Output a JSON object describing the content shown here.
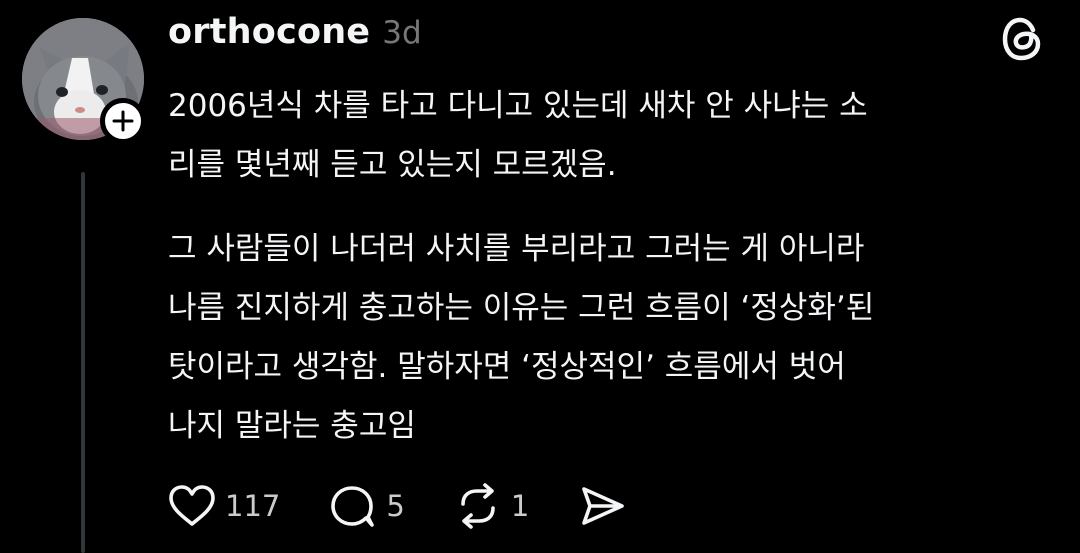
{
  "post": {
    "username": "orthocone",
    "timestamp": "3d",
    "paragraphs": [
      [
        "2006년식 차를 타고 다니고 있는데 새차 안 사냐는 소",
        "리를 몇년째 듣고 있는지 모르겠음."
      ],
      [
        "그 사람들이 나더러 사치를 부리라고 그러는 게 아니라",
        "나름 진지하게 충고하는 이유는 그런 흐름이 ‘정상화’된",
        "탓이라고 생각함. 말하자면 ‘정상적인’ 흐름에서 벗어",
        "나지 말라는 충고임"
      ]
    ]
  },
  "actions": {
    "like_count": "117",
    "reply_count": "5",
    "repost_count": "1"
  },
  "icons": {
    "avatar": "cat-avatar",
    "follow": "plus-icon",
    "logo": "threads-logo-icon",
    "like": "heart-icon",
    "reply": "comment-icon",
    "repost": "repost-icon",
    "share": "send-icon"
  },
  "colors": {
    "background": "#000000",
    "text": "#f3f5f7",
    "muted": "#777777",
    "thread_line": "#333638"
  }
}
